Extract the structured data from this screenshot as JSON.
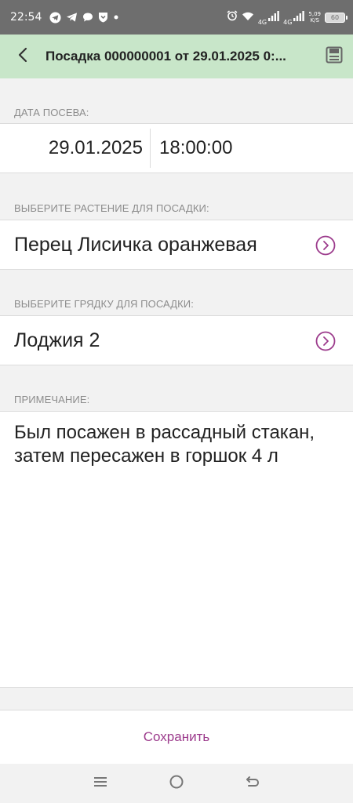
{
  "status_bar": {
    "time": "22:54",
    "network_1": "4G",
    "network_2": "4G",
    "speed_value": "5,09",
    "speed_unit": "K/S",
    "battery": "60"
  },
  "toolbar": {
    "title": "Посадка 000000001 от 29.01.2025 0:..."
  },
  "sowing_date": {
    "label": "ДАТА ПОСЕВА:",
    "date": "29.01.2025",
    "time": "18:00:00"
  },
  "plant": {
    "label": "ВЫБЕРИТЕ РАСТЕНИЕ ДЛЯ ПОСАДКИ:",
    "value": "Перец Лисичка оранжевая"
  },
  "bed": {
    "label": "ВЫБЕРИТЕ ГРЯДКУ ДЛЯ ПОСАДКИ:",
    "value": "Лоджия 2"
  },
  "note": {
    "label": "ПРИМЕЧАНИЕ:",
    "value": "Был посажен в рассадный стакан, затем пересажен  в горшок 4 л"
  },
  "actions": {
    "save_label": "Сохранить"
  },
  "colors": {
    "toolbar_bg": "#c8e6c9",
    "accent": "#9c3b8c",
    "status_bar_bg": "#6e6e6e"
  },
  "icons": [
    "telegram-icon",
    "telegram-icon",
    "chat-bubble-icon",
    "shield-icon",
    "alarm-icon",
    "wifi-icon",
    "signal-icon",
    "battery-icon",
    "back-arrow-icon",
    "save-disk-icon",
    "chevron-right-circle-icon",
    "menu-icon",
    "home-icon",
    "back-icon"
  ]
}
